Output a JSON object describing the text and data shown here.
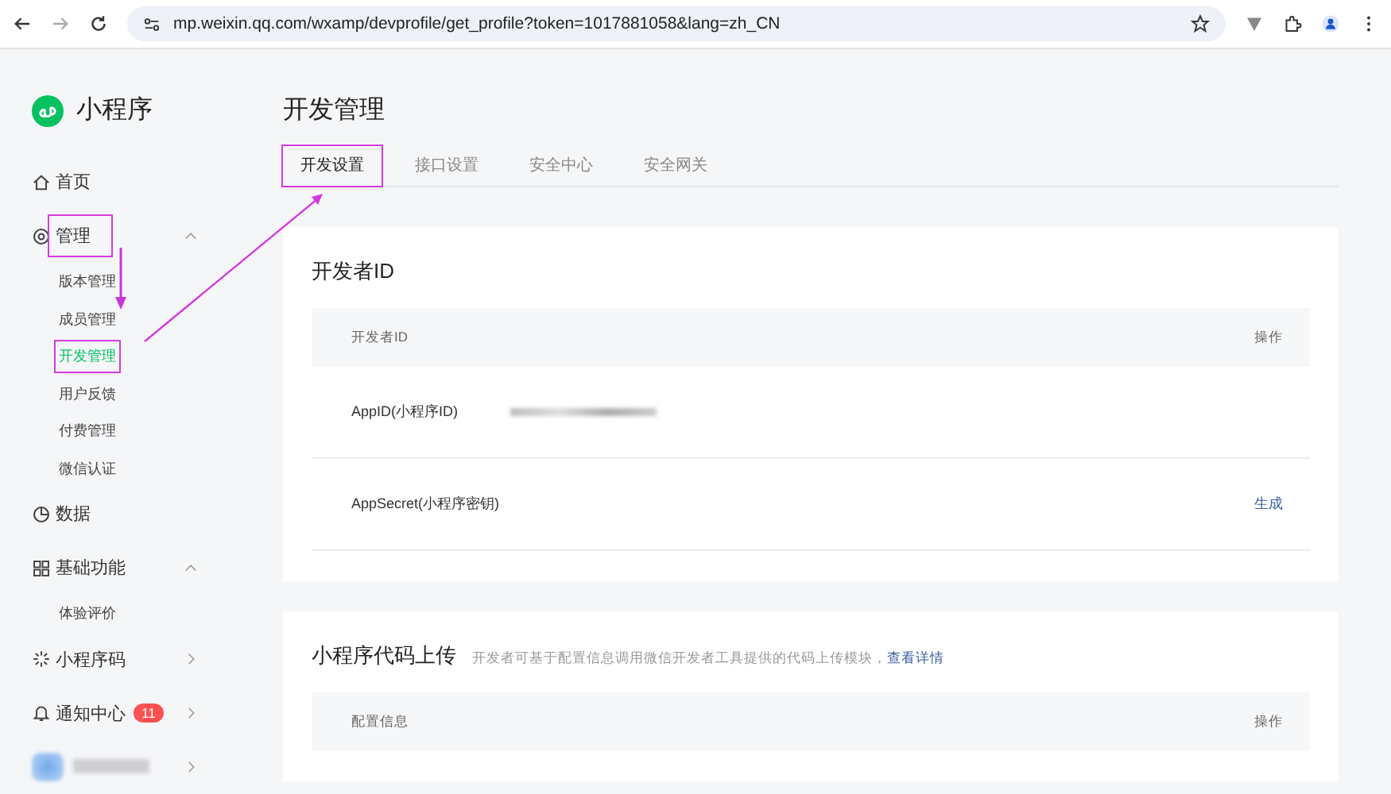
{
  "browser": {
    "url": "mp.weixin.qq.com/wxamp/devprofile/get_profile?token=1017881058&lang=zh_CN"
  },
  "sidebar": {
    "logo": "小程序",
    "items": [
      {
        "kind": "link",
        "label": "首页",
        "annotated": false
      },
      {
        "kind": "group",
        "label": "管理",
        "expanded": true,
        "annotated": true,
        "children": [
          {
            "label": "版本管理",
            "selected": false
          },
          {
            "label": "成员管理",
            "selected": false
          },
          {
            "label": "开发管理",
            "selected": true,
            "annotated": true
          },
          {
            "label": "用户反馈",
            "selected": false
          },
          {
            "label": "付费管理",
            "selected": false
          },
          {
            "label": "微信认证",
            "selected": false
          }
        ]
      },
      {
        "kind": "link",
        "label": "数据",
        "annotated": false
      },
      {
        "kind": "group",
        "label": "基础功能",
        "expanded": true,
        "annotated": false,
        "children": [
          {
            "label": "体验评价",
            "selected": false
          }
        ]
      },
      {
        "kind": "menu",
        "label": "小程序码"
      },
      {
        "kind": "menu",
        "label": "通知中心",
        "badge": "11"
      },
      {
        "kind": "account",
        "name_redacted": true
      }
    ]
  },
  "page": {
    "title": "开发管理",
    "tabs": [
      {
        "label": "开发设置",
        "selected": true,
        "annotated": true
      },
      {
        "label": "接口设置",
        "selected": false,
        "annotated": false
      },
      {
        "label": "安全中心",
        "selected": false,
        "annotated": false
      },
      {
        "label": "安全网关",
        "selected": false,
        "annotated": false
      }
    ],
    "cards": [
      {
        "title": "开发者ID",
        "table": {
          "columns": [
            "开发者ID",
            "操作"
          ],
          "rows": [
            {
              "label": "AppID(小程序ID)",
              "value_redacted": true
            },
            {
              "label": "AppSecret(小程序密钥)",
              "value_redacted": false,
              "action": "生成"
            }
          ]
        }
      },
      {
        "title": "小程序代码上传",
        "description": "开发者可基于配置信息调用微信开发者工具提供的代码上传模块，",
        "link": "查看详情",
        "table": {
          "columns": [
            "配置信息",
            "操作"
          ]
        }
      }
    ]
  }
}
